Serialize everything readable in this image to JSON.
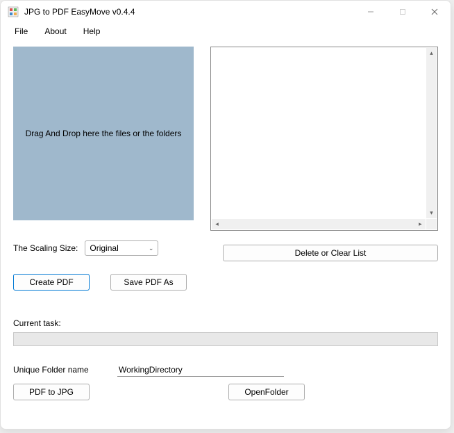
{
  "title": "JPG to PDF EasyMove v0.4.4",
  "menu": {
    "file": "File",
    "about": "About",
    "help": "Help"
  },
  "drop_zone_text": "Drag And Drop here the files or the folders",
  "scaling": {
    "label": "The Scaling Size:",
    "selected": "Original"
  },
  "buttons": {
    "delete_clear": "Delete or Clear List",
    "create_pdf": "Create PDF",
    "save_pdf_as": "Save PDF As",
    "pdf_to_jpg": "PDF to JPG",
    "open_folder": "OpenFolder"
  },
  "current_task_label": "Current task:",
  "folder": {
    "label": "Unique Folder name",
    "value": "WorkingDirectory"
  }
}
